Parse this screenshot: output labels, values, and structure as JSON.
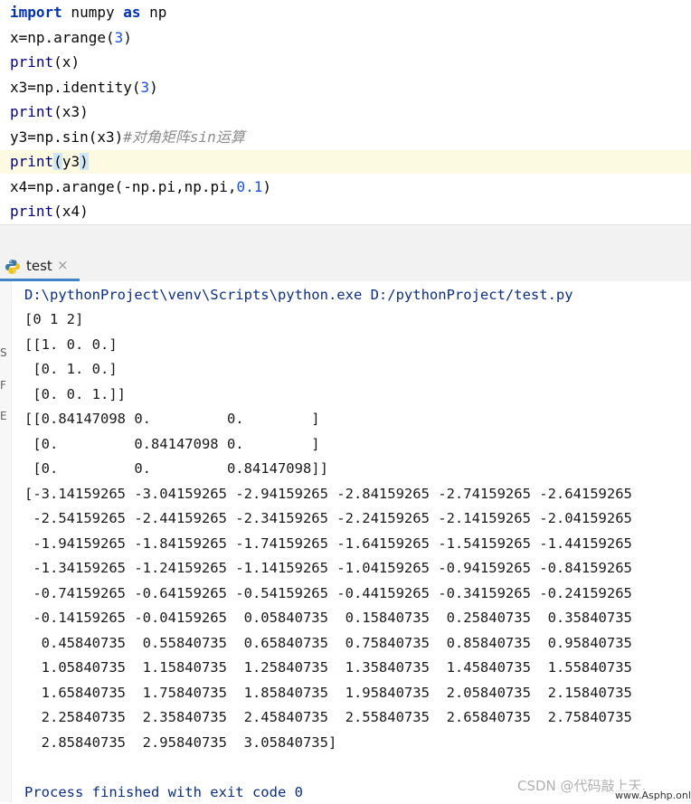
{
  "editor": {
    "lines": [
      {
        "kw": "import",
        "mid": " numpy ",
        "kw2": "as",
        "tail": " np"
      },
      {
        "pre": "x=np.arange(",
        "num": "3",
        "post": ")"
      },
      {
        "fn": "print",
        "post": "(x)"
      },
      {
        "pre": "x3=np.identity(",
        "num": "3",
        "post": ")"
      },
      {
        "fn": "print",
        "post": "(x3)"
      },
      {
        "pre": "y3=np.sin(x3)",
        "comment": "#对角矩阵sin运算"
      },
      {
        "fn": "print",
        "open": "(",
        "arg": "y3",
        "close": ")"
      },
      {
        "pre": "x4=np.arange(-np.pi,np.pi,",
        "num": "0.1",
        "post": ")"
      },
      {
        "fn": "print",
        "post": "(x4)"
      }
    ]
  },
  "run_panel": {
    "tab_label": "test",
    "tab_close": "×",
    "gutter_marks": [
      "S",
      "F",
      "E"
    ]
  },
  "console": {
    "command": "D:\\pythonProject\\venv\\Scripts\\python.exe D:/pythonProject/test.py",
    "output": [
      "[0 1 2]",
      "[[1. 0. 0.]",
      " [0. 1. 0.]",
      " [0. 0. 1.]]",
      "[[0.84147098 0.         0.        ]",
      " [0.         0.84147098 0.        ]",
      " [0.         0.         0.84147098]]",
      "[-3.14159265 -3.04159265 -2.94159265 -2.84159265 -2.74159265 -2.64159265",
      " -2.54159265 -2.44159265 -2.34159265 -2.24159265 -2.14159265 -2.04159265",
      " -1.94159265 -1.84159265 -1.74159265 -1.64159265 -1.54159265 -1.44159265",
      " -1.34159265 -1.24159265 -1.14159265 -1.04159265 -0.94159265 -0.84159265",
      " -0.74159265 -0.64159265 -0.54159265 -0.44159265 -0.34159265 -0.24159265",
      " -0.14159265 -0.04159265  0.05840735  0.15840735  0.25840735  0.35840735",
      "  0.45840735  0.55840735  0.65840735  0.75840735  0.85840735  0.95840735",
      "  1.05840735  1.15840735  1.25840735  1.35840735  1.45840735  1.55840735",
      "  1.65840735  1.75840735  1.85840735  1.95840735  2.05840735  2.15840735",
      "  2.25840735  2.35840735  2.45840735  2.55840735  2.65840735  2.75840735",
      "  2.85840735  2.95840735  3.05840735]"
    ],
    "process_line": "Process finished with exit code 0"
  },
  "watermark": {
    "csdn": "CSDN @代码敲上天.",
    "site": "www.Asphp.online"
  }
}
